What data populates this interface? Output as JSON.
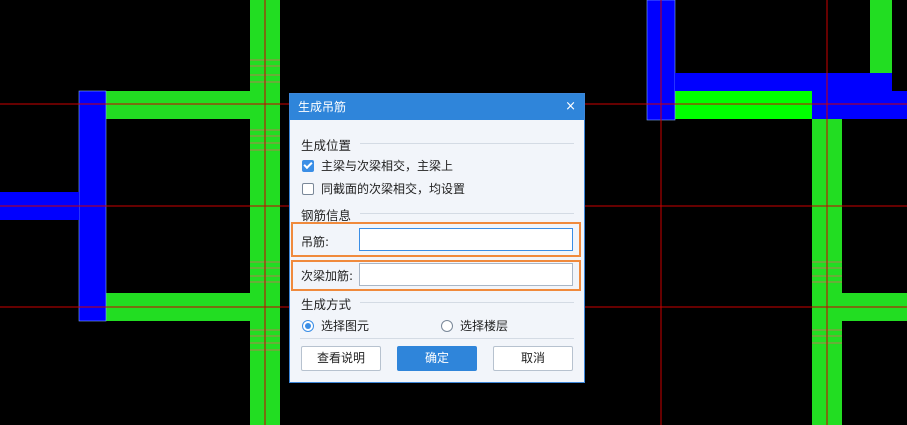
{
  "canvas": {
    "colors": {
      "background": "#000000",
      "column": "#0000ff",
      "beam": "#22dd22",
      "beam_bright": "#00ff00",
      "axis_line": "#cc0000",
      "beam_edge": "#e06060"
    }
  },
  "dialog": {
    "title": "生成吊筋",
    "close_glyph": "×",
    "position_section": {
      "title": "生成位置",
      "options": [
        {
          "label": "主梁与次梁相交，主梁上",
          "checked": true
        },
        {
          "label": "同截面的次梁相交，均设置",
          "checked": false
        }
      ]
    },
    "rebar_section": {
      "title": "钢筋信息",
      "hanger": {
        "label": "吊筋:",
        "value": ""
      },
      "secondary": {
        "label": "次梁加筋:",
        "value": ""
      }
    },
    "method_section": {
      "title": "生成方式",
      "options": [
        {
          "label": "选择图元",
          "selected": true
        },
        {
          "label": "选择楼层",
          "selected": false
        }
      ]
    },
    "buttons": {
      "help": "查看说明",
      "ok": "确定",
      "cancel": "取消"
    },
    "colors": {
      "accent": "#2f85da",
      "highlight": "#f08a3c"
    }
  }
}
